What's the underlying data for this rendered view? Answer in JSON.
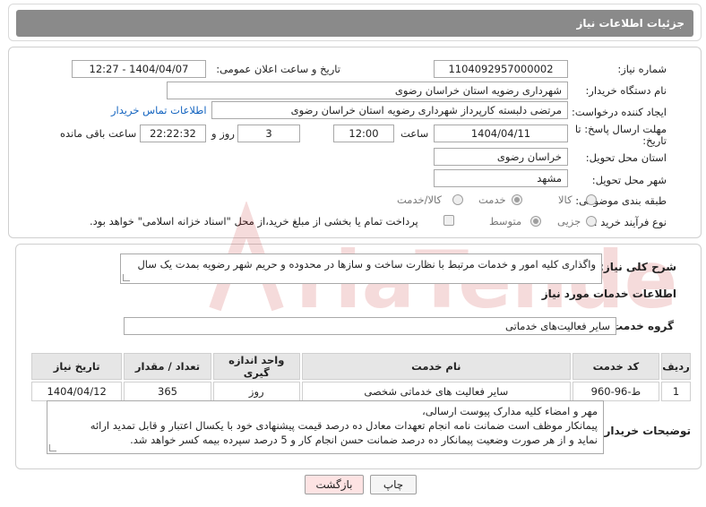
{
  "header": {
    "title": "جزئیات اطلاعات نیاز"
  },
  "fields": {
    "need_number_label": "شماره نیاز:",
    "need_number": "1104092957000002",
    "announce_label": "تاریخ و ساعت اعلان عمومی:",
    "announce_value": "1404/04/07 - 12:27",
    "buyer_org_label": "نام دستگاه خریدار:",
    "buyer_org": "شهرداری رضویه استان خراسان رضوی",
    "creator_label": "ایجاد کننده درخواست:",
    "creator": "مرتضی دلبسته کارپرداز شهرداری رضویه استان خراسان رضوی",
    "contact_link": "اطلاعات تماس خریدار",
    "deadline_label_1": "مهلت ارسال پاسخ: تا",
    "deadline_label_2": "تاریخ:",
    "deadline_date": "1404/04/11",
    "time_label": "ساعت",
    "deadline_time": "12:00",
    "days_value": "3",
    "days_label": "روز و",
    "remaining_time": "22:22:32",
    "remaining_label": "ساعت باقی مانده",
    "province_label": "استان محل تحویل:",
    "province": "خراسان رضوی",
    "city_label": "شهر محل تحویل:",
    "city": "مشهد",
    "category_label": "طبقه بندی موضوعی:",
    "category_options": [
      "کالا",
      "خدمت",
      "کالا/خدمت"
    ],
    "category_selected": "خدمت",
    "process_label": "نوع فرآیند خرید :",
    "process_options": [
      "جزیی",
      "متوسط"
    ],
    "process_selected": "متوسط",
    "payment_note": "پرداخت تمام یا بخشی از مبلغ خرید،از محل \"اسناد خزانه اسلامی\" خواهد بود."
  },
  "summary": {
    "label": "شرح کلی نیاز:",
    "text": "واگذاری کلیه امور و خدمات مرتبط با نظارت ساخت و سازها در محدوده و حریم شهر رضویه بمدت یک سال"
  },
  "services": {
    "section_title": "اطلاعات خدمات مورد نیاز",
    "group_label": "گروه خدمت:",
    "group_value": "سایر فعالیت‌های خدماتی",
    "columns": [
      "ردیف",
      "کد خدمت",
      "نام خدمت",
      "واحد اندازه گیری",
      "تعداد / مقدار",
      "تاریخ نیاز"
    ],
    "rows": [
      [
        "1",
        "ط-96-960",
        "سایر فعالیت های خدماتی شخصی",
        "روز",
        "365",
        "1404/04/12"
      ]
    ]
  },
  "notes": {
    "label": "توضیحات خریدار:",
    "lines": [
      "مهر و امضاء کلیه مدارک پیوست ارسالی،",
      "پیمانکار موظف است ضمانت نامه انجام تعهدات معادل  ده درصد قیمت پیشنهادی خود با یکسال اعتبار و قابل تمدید ارائه",
      "نماید و از هر صورت وضعیت پیمانکار ده درصد ضمانت حسن انجام کار و 5 درصد سپرده بیمه کسر خواهد شد."
    ]
  },
  "buttons": {
    "print": "چاپ",
    "back": "بازگشت"
  },
  "watermark": {
    "text": "AriaTender.net"
  },
  "colors": {
    "header_bar": "#8a8a8a",
    "link": "#1565c0",
    "back_button_bg": "#fde3e3",
    "watermark": "#c62828"
  }
}
